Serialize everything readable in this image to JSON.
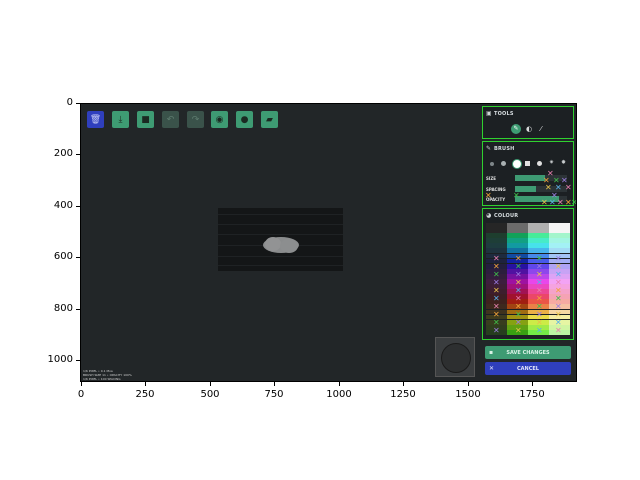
{
  "axes": {
    "y_ticks": [
      "0",
      "200",
      "400",
      "600",
      "800",
      "1000"
    ],
    "x_ticks": [
      "0",
      "250",
      "500",
      "750",
      "1000",
      "1250",
      "1500",
      "1750"
    ]
  },
  "toolbar": {
    "buttons": [
      {
        "name": "trash",
        "icon": "trash-icon",
        "glyph": "🗑",
        "style": "blue"
      },
      {
        "name": "download",
        "icon": "download-icon",
        "glyph": "⤓",
        "style": "green"
      },
      {
        "name": "save",
        "icon": "floppy-icon",
        "glyph": "■",
        "style": "green"
      },
      {
        "name": "undo",
        "icon": "undo-icon",
        "glyph": "↶",
        "style": "dim"
      },
      {
        "name": "redo",
        "icon": "redo-icon",
        "glyph": "↷",
        "style": "dim"
      },
      {
        "name": "camera",
        "icon": "camera-icon",
        "glyph": "◉",
        "style": "green"
      },
      {
        "name": "hint",
        "icon": "lightbulb-icon",
        "glyph": "●",
        "style": "green"
      },
      {
        "name": "chat",
        "icon": "chat-icon",
        "glyph": "▰",
        "style": "green"
      }
    ]
  },
  "tools_panel": {
    "title": "TOOLS",
    "tools": [
      "brush-icon",
      "eraser-icon",
      "picker-icon"
    ],
    "selected": 0
  },
  "brush_panel": {
    "title": "BRUSH",
    "sliders": [
      {
        "label": "SIZE",
        "level": 0.58
      },
      {
        "label": "SPACING",
        "level": 0.4
      },
      {
        "label": "OPACITY",
        "level": 0.85
      }
    ]
  },
  "colour_panel": {
    "title": "COLOUR"
  },
  "actions": {
    "save_changes": "SAVE CHANGES",
    "cancel": "CANCEL"
  },
  "footer": {
    "lines": [
      "1/6 PIXEL • 0.1 Moa",
      "BRUSH SIZE 11 • OPACITY 100%",
      "1/6 PIXEL • 100 SPACING"
    ]
  },
  "colors": {
    "accent_green": "#3e9b73",
    "panel_border": "#2fd12f",
    "cancel_blue": "#2f3fbd"
  }
}
